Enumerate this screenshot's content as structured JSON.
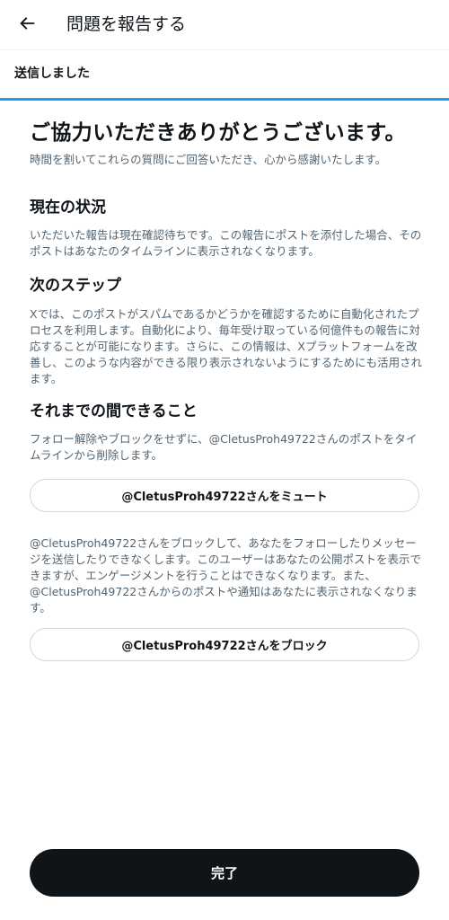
{
  "header": {
    "title": "問題を報告する",
    "back_icon": "arrow-left-icon"
  },
  "tab": {
    "label": "送信しました",
    "accent_color": "#1d9bf0"
  },
  "main": {
    "title": "ご協力いただきありがとうございます。",
    "subtitle": "時間を割いてこれらの質問にご回答いただき、心から感謝いたします。"
  },
  "sections": {
    "current": {
      "heading": "現在の状況",
      "body": "いただいた報告は現在確認待ちです。この報告にポストを添付した場合、そのポストはあなたのタイムラインに表示されなくなります。"
    },
    "next": {
      "heading": "次のステップ",
      "body": "Xでは、このポストがスパムであるかどうかを確認するために自動化されたプロセスを利用します。自動化により、毎年受け取っている何億件もの報告に対応することが可能になります。さらに、この情報は、Xプラットフォームを改善し、このような内容ができる限り表示されないようにするためにも活用されます。"
    },
    "meanwhile": {
      "heading": "それまでの間できること",
      "mute_text": "フォロー解除やブロックをせずに、@CletusProh49722さんのポストをタイムラインから削除します。",
      "mute_button": "@CletusProh49722さんをミュート",
      "block_text": "@CletusProh49722さんをブロックして、あなたをフォローしたりメッセージを送信したりできなくします。このユーザーはあなたの公開ポストを表示できますが、エンゲージメントを行うことはできなくなります。また、@CletusProh49722さんからのポストや通知はあなたに表示されなくなります。",
      "block_button": "@CletusProh49722さんをブロック"
    }
  },
  "footer": {
    "done_button": "完了"
  }
}
